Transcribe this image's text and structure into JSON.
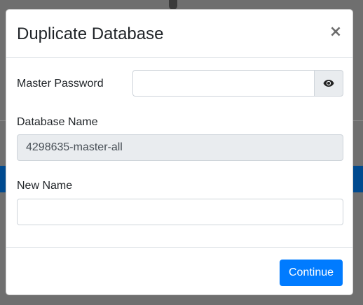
{
  "modal": {
    "title": "Duplicate Database",
    "close_label": "×"
  },
  "form": {
    "master_password": {
      "label": "Master Password",
      "value": "",
      "toggle_icon": "eye-icon"
    },
    "database_name": {
      "label": "Database Name",
      "value": "4298635-master-all",
      "readonly": true
    },
    "new_name": {
      "label": "New Name",
      "value": ""
    }
  },
  "footer": {
    "continue_label": "Continue"
  },
  "colors": {
    "primary": "#007bff",
    "readonly_bg": "#e9ecef",
    "backdrop": "#6f6f6f",
    "bg_accent": "#004a8f"
  }
}
